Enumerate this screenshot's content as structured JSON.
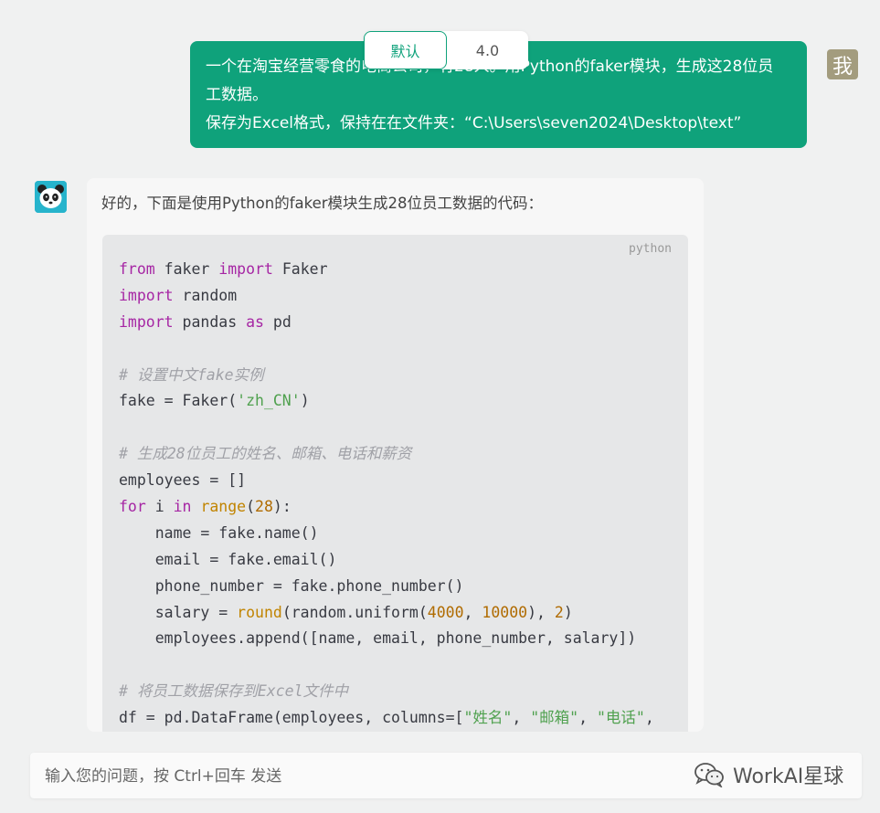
{
  "model_switch": {
    "options": [
      "默认",
      "4.0"
    ],
    "selected": "默认"
  },
  "user_message": {
    "line1": "一个在淘宝经营零食的电商公司，有28人。用Python的faker模块，生成这28位员",
    "line2": "工数据。",
    "line3": "保存为Excel格式，保持在在文件夹：“C:\\Users\\seven2024\\Desktop\\text”",
    "avatar_text": "我"
  },
  "bot_message": {
    "intro": "好的，下面是使用Python的faker模块生成28位员工数据的代码：",
    "code_language": "python",
    "code_lines": [
      "from faker import Faker",
      "import random",
      "import pandas as pd",
      "",
      "# 设置中文fake实例",
      "fake = Faker('zh_CN')",
      "",
      "# 生成28位员工的姓名、邮箱、电话和薪资",
      "employees = []",
      "for i in range(28):",
      "    name = fake.name()",
      "    email = fake.email()",
      "    phone_number = fake.phone_number()",
      "    salary = round(random.uniform(4000, 10000), 2)",
      "    employees.append([name, email, phone_number, salary])",
      "",
      "# 将员工数据保存到Excel文件中",
      "df = pd.DataFrame(employees, columns=[\"姓名\", \"邮箱\", \"电话\","
    ]
  },
  "input": {
    "placeholder": "输入您的问题，按 Ctrl+回车 发送"
  },
  "watermark": {
    "text": "WorkAI星球",
    "icon": "wechat-icon"
  },
  "colors": {
    "accent": "#0fa27b",
    "user_avatar": "#a39c7e",
    "bot_avatar": "#27b4cc"
  }
}
